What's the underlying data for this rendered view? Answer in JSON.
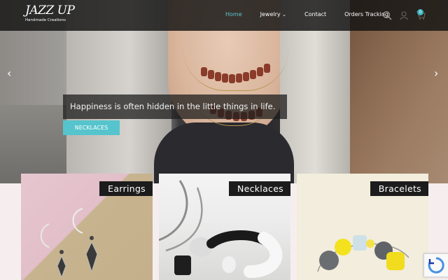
{
  "brand": {
    "name": "JAZZ UP",
    "tagline": "Handmade Creations"
  },
  "nav": {
    "items": [
      {
        "label": "Home",
        "active": true
      },
      {
        "label": "Jewelry",
        "has_dropdown": true
      },
      {
        "label": "Contact"
      },
      {
        "label": "Orders Tracking"
      }
    ]
  },
  "cart": {
    "count": "0"
  },
  "icons": [
    "search-icon",
    "user-icon",
    "cart-icon",
    "chevron-left-icon",
    "chevron-right-icon",
    "recaptcha-icon"
  ],
  "hero": {
    "caption": "Happiness is often hidden in the little things in life.",
    "button": "NECKLACES",
    "prev": "‹",
    "next": "›"
  },
  "categories": [
    {
      "label": "Earrings"
    },
    {
      "label": "Necklaces"
    },
    {
      "label": "Bracelets"
    }
  ],
  "colors": {
    "accent": "#56c4cc",
    "header_bg": "#121212",
    "label_bg": "#1c1c1c"
  }
}
